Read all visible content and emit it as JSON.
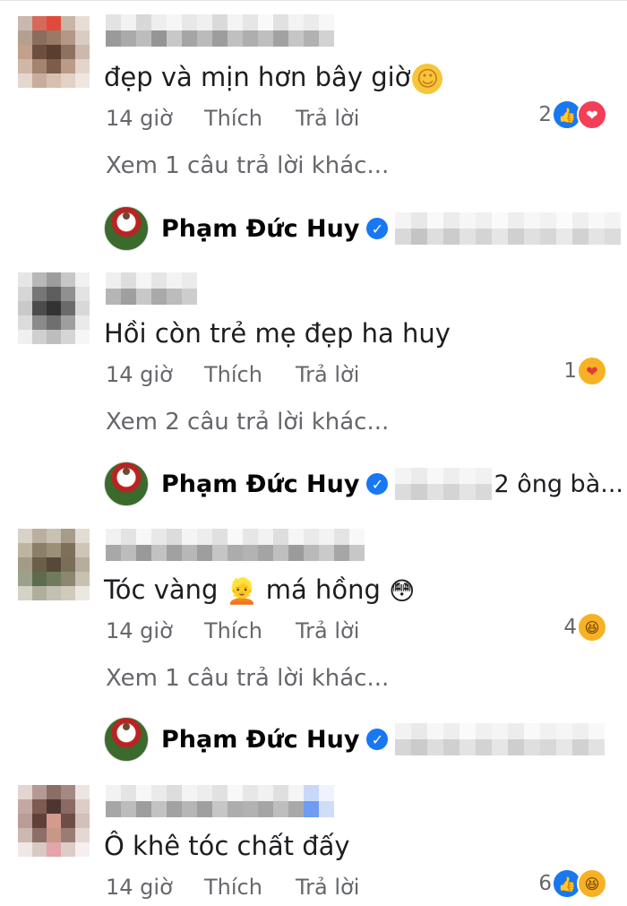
{
  "comments": [
    {
      "text": "đẹp và mịn hơn bây giờ",
      "text_emoji": "☺",
      "time": "14 giờ",
      "like_label": "Thích",
      "reply_label": "Trả lời",
      "reaction_count": "2",
      "reactions": [
        "like-icon",
        "love-icon"
      ],
      "more_replies": "Xem 1 câu trả lời khác...",
      "reply": {
        "name": "Phạm Đức Huy",
        "verified": true,
        "preview_tail": ""
      }
    },
    {
      "text": "Hồi còn trẻ mẹ đẹp ha huy",
      "time": "14 giờ",
      "like_label": "Thích",
      "reply_label": "Trả lời",
      "reaction_count": "1",
      "reactions": [
        "care-icon"
      ],
      "more_replies": "Xem 2 câu trả lời khác...",
      "reply": {
        "name": "Phạm Đức Huy",
        "verified": true,
        "preview_tail": "2 ông bà..."
      }
    },
    {
      "text_before": "Tóc vàng",
      "text_middle_emoji": "👱",
      "text_after": "má hồng",
      "text_end_emoji": "😳",
      "time": "14 giờ",
      "like_label": "Thích",
      "reply_label": "Trả lời",
      "reaction_count": "4",
      "reactions": [
        "haha-icon"
      ],
      "more_replies": "Xem 1 câu trả lời khác...",
      "reply": {
        "name": "Phạm Đức Huy",
        "verified": true,
        "preview_tail": ""
      }
    },
    {
      "text": "Ô khê tóc chất đấy",
      "time": "14 giờ",
      "like_label": "Thích",
      "reply_label": "Trả lời",
      "reaction_count": "6",
      "reactions": [
        "like-icon",
        "haha-icon"
      ]
    }
  ],
  "colors": {
    "secondary_text": "#65676b",
    "like_blue": "#1877f2",
    "love_red": "#f33e58",
    "haha_yellow": "#f7b125"
  }
}
